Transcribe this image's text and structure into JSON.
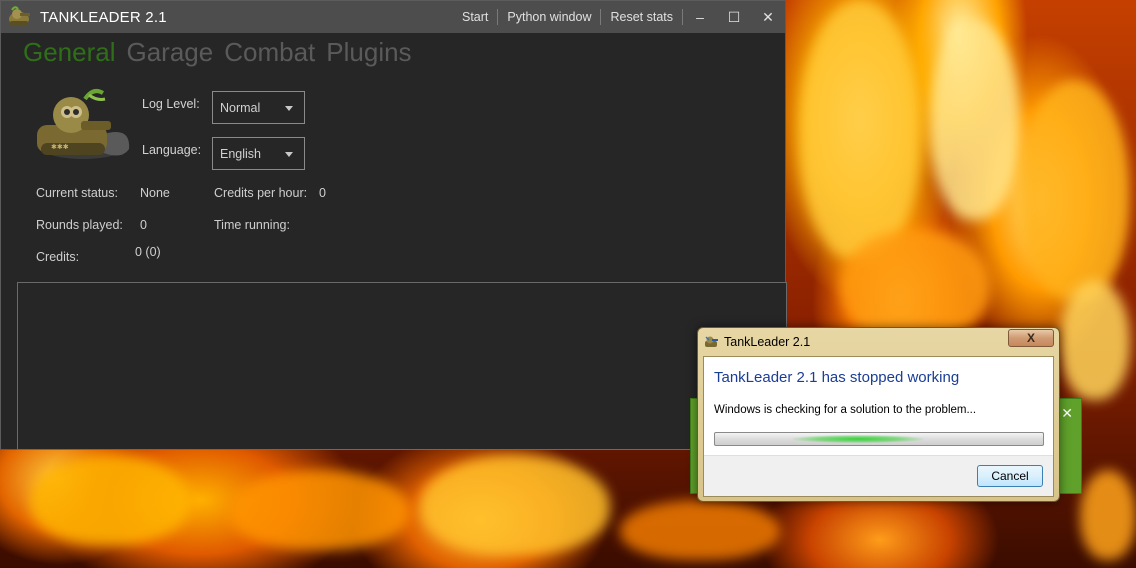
{
  "app": {
    "title": "TANKLEADER 2.1",
    "actions": [
      "Start",
      "Python window",
      "Reset stats"
    ],
    "controls": {
      "minimize": "–",
      "maximize": "☐",
      "close": "✕"
    },
    "tabs": [
      {
        "label": "General",
        "active": true
      },
      {
        "label": "Garage",
        "active": false
      },
      {
        "label": "Combat",
        "active": false
      },
      {
        "label": "Plugins",
        "active": false
      }
    ],
    "settings": {
      "log_level_label": "Log Level:",
      "log_level_value": "Normal",
      "language_label": "Language:",
      "language_value": "English"
    },
    "stats": {
      "current_status_label": "Current status:",
      "current_status_value": "None",
      "credits_per_hour_label": "Credits per hour:",
      "credits_per_hour_value": "0",
      "rounds_played_label": "Rounds played:",
      "rounds_played_value": "0",
      "time_running_label": "Time running:",
      "credits_label": "Credits:",
      "credits_value": "0 (0)"
    },
    "colors": {
      "background": "#262626",
      "titlebar": "#4d4d4d",
      "active_tab": "#2f6f19",
      "inactive_tab": "#5a5a5a"
    }
  },
  "dialog": {
    "title": "TankLeader 2.1",
    "close_label": "X",
    "main_instruction": "TankLeader 2.1 has stopped working",
    "message": "Windows is checking for a solution to the problem...",
    "cancel_label": "Cancel",
    "icons": {
      "title_icon": "app-icon",
      "close": "close-icon"
    }
  }
}
